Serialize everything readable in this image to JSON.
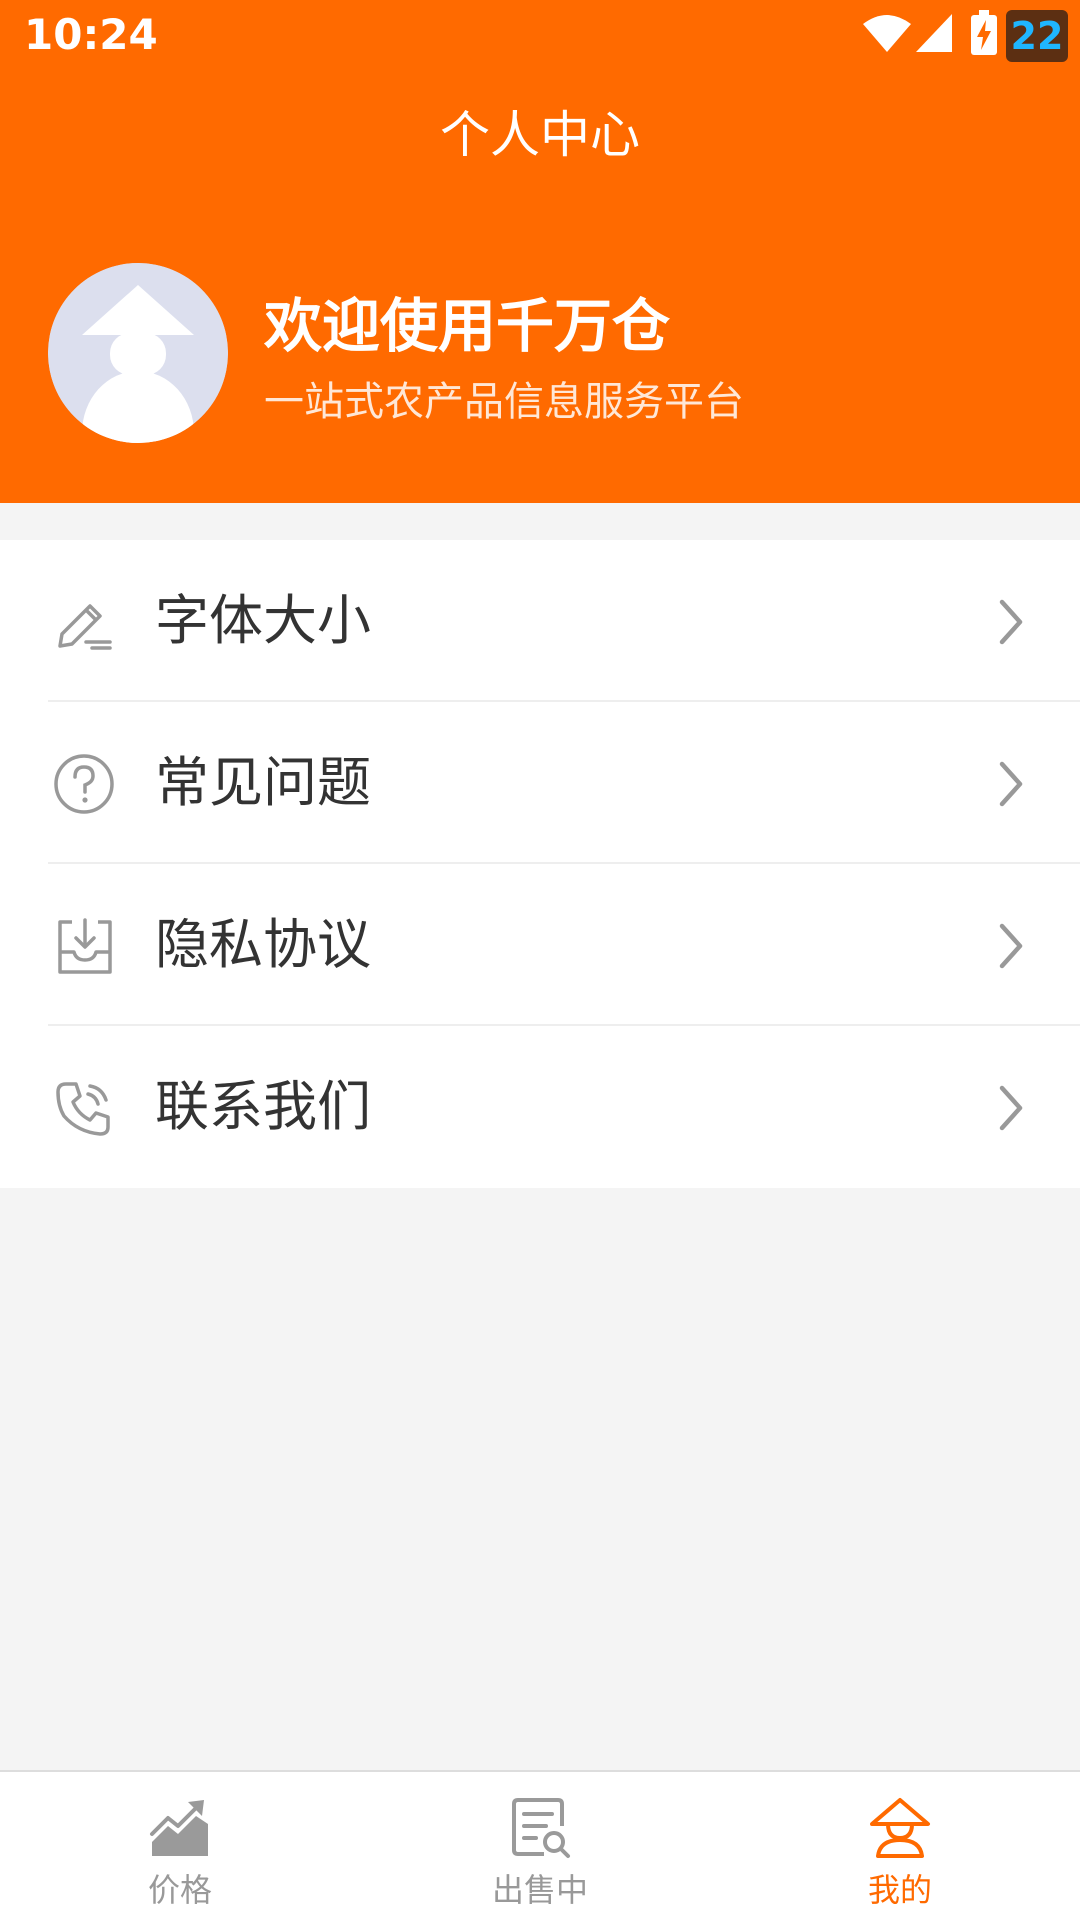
{
  "status_bar": {
    "time": "10:24",
    "battery_level": "22",
    "icons": [
      "wifi-icon",
      "signal-icon",
      "battery-charging-icon"
    ]
  },
  "header": {
    "title": "个人中心",
    "welcome_title": "欢迎使用千万仓",
    "welcome_subtitle": "一站式农产品信息服务平台",
    "background_color": "#ff6a00"
  },
  "menu": {
    "items": [
      {
        "label": "字体大小",
        "icon": "edit-pencil-icon"
      },
      {
        "label": "常见问题",
        "icon": "question-circle-icon"
      },
      {
        "label": "隐私协议",
        "icon": "inbox-download-icon"
      },
      {
        "label": "联系我们",
        "icon": "phone-icon"
      }
    ]
  },
  "tab_bar": {
    "tabs": [
      {
        "label": "价格",
        "icon": "trend-chart-icon",
        "active": false
      },
      {
        "label": "出售中",
        "icon": "document-search-icon",
        "active": false
      },
      {
        "label": "我的",
        "icon": "profile-user-icon",
        "active": true
      }
    ],
    "active_color": "#ff6a00",
    "inactive_color": "#999999"
  }
}
